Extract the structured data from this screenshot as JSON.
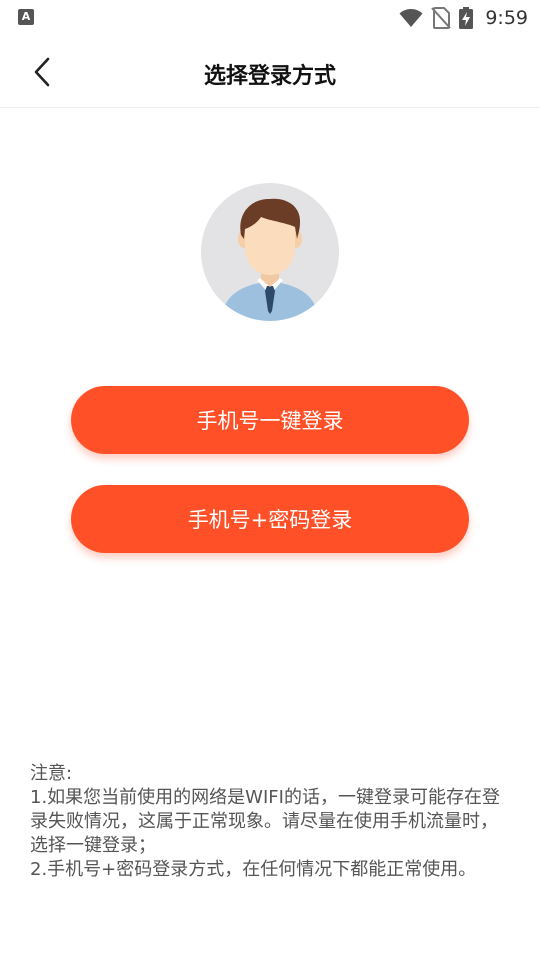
{
  "status_bar": {
    "left_icon_letter": "A",
    "time": "9:59",
    "icons": [
      "wifi-icon",
      "no-sim-icon",
      "battery-charging-icon"
    ]
  },
  "app_bar": {
    "title": "选择登录方式",
    "back_icon": "chevron-left-icon"
  },
  "avatar": {
    "icon": "user-avatar-icon"
  },
  "buttons": {
    "one_click_login": "手机号一键登录",
    "password_login": "手机号+密码登录"
  },
  "notice": {
    "heading": "注意:",
    "item1": " 1.如果您当前使用的网络是WIFI的话，一键登录可能存在登录失败情况，这属于正常现象。请尽量在使用手机流量时，选择一键登录；",
    "item2": " 2.手机号+密码登录方式，在任何情况下都能正常使用。"
  },
  "colors": {
    "accent": "#ff5028",
    "background": "#ffffff",
    "notice_text": "#555555"
  }
}
